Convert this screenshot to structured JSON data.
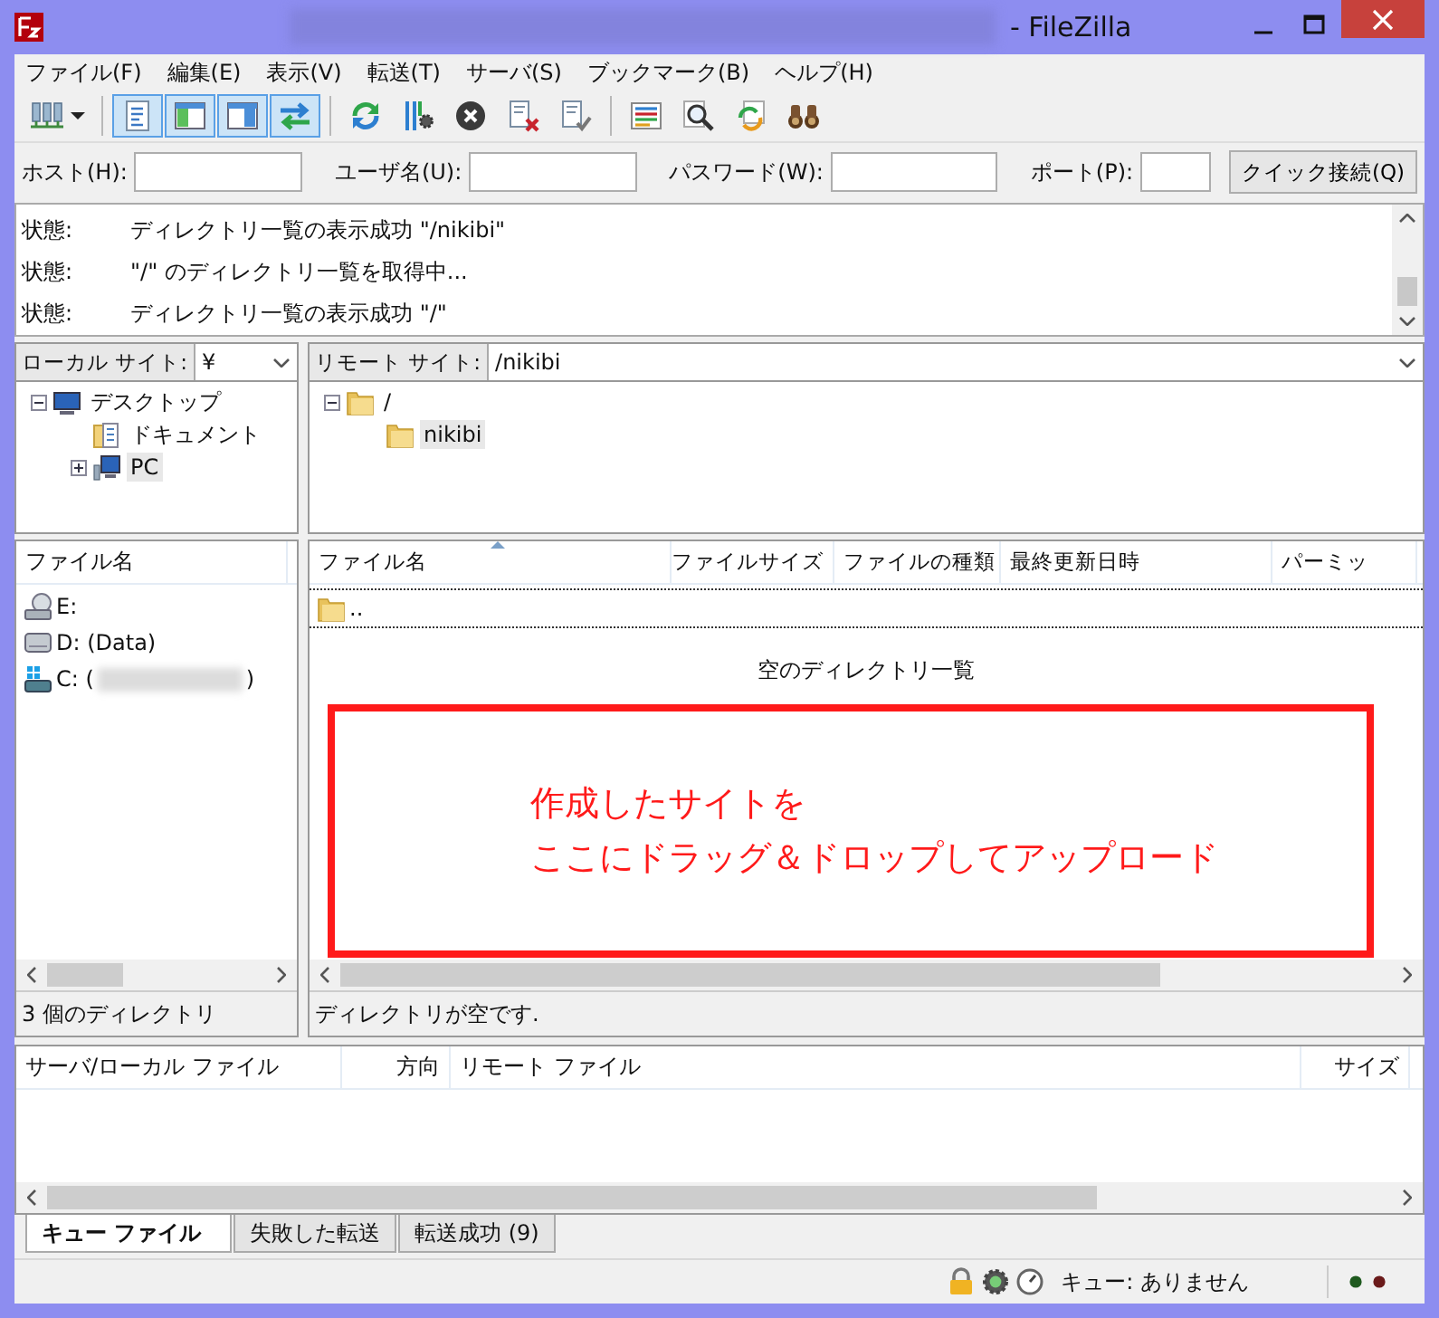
{
  "window": {
    "title": "- FileZilla"
  },
  "menu": [
    "ファイル(F)",
    "編集(E)",
    "表示(V)",
    "転送(T)",
    "サーバ(S)",
    "ブックマーク(B)",
    "ヘルプ(H)"
  ],
  "toolbar": [
    {
      "kind": "site_manager",
      "pressed": false
    },
    {
      "kind": "separator"
    },
    {
      "kind": "message_log",
      "pressed": true
    },
    {
      "kind": "local_tree",
      "pressed": true
    },
    {
      "kind": "remote_tree",
      "pressed": true
    },
    {
      "kind": "transfer_queue",
      "pressed": true
    },
    {
      "kind": "separator"
    },
    {
      "kind": "refresh",
      "pressed": false
    },
    {
      "kind": "filter",
      "pressed": false
    },
    {
      "kind": "cancel",
      "pressed": false
    },
    {
      "kind": "disconnect",
      "pressed": false
    },
    {
      "kind": "reconnect",
      "pressed": false
    },
    {
      "kind": "separator"
    },
    {
      "kind": "list_view",
      "pressed": false
    },
    {
      "kind": "search",
      "pressed": false
    },
    {
      "kind": "sync",
      "pressed": false
    },
    {
      "kind": "compare",
      "pressed": false
    }
  ],
  "quickconnect": {
    "fields": [
      {
        "label": "ホスト(H):"
      },
      {
        "label": "ユーザ名(U):"
      },
      {
        "label": "パスワード(W):"
      },
      {
        "label": "ポート(P):"
      }
    ],
    "button": "クイック接続(Q)"
  },
  "log": [
    {
      "label": "状態:",
      "message": "ディレクトリ一覧の表示成功 \"/nikibi\""
    },
    {
      "label": "状態:",
      "message": "\"/\" のディレクトリ一覧を取得中..."
    },
    {
      "label": "状態:",
      "message": "ディレクトリ一覧の表示成功 \"/\""
    }
  ],
  "local": {
    "site_label": "ローカル サイト:",
    "path": "¥",
    "tree": [
      {
        "label": "デスクトップ",
        "kind": "desktop",
        "expanded": true,
        "selected": false,
        "children": [
          {
            "label": "ドキュメント",
            "kind": "documents",
            "selected": false
          },
          {
            "label": "PC",
            "kind": "computer",
            "expanded": false,
            "selected": true
          }
        ]
      }
    ],
    "columns": [
      "ファイル名"
    ],
    "files": [
      {
        "name": "E:",
        "kind": "optical_drive"
      },
      {
        "name": "D: (Data)",
        "kind": "drive"
      },
      {
        "name": "C: (",
        "kind": "system_drive",
        "after_redaction": ")"
      }
    ],
    "status": "3 個のディレクトリ"
  },
  "remote": {
    "site_label": "リモート サイト:",
    "path": "/nikibi",
    "tree": [
      {
        "label": "/",
        "kind": "folder",
        "expanded": true,
        "selected": false,
        "children": [
          {
            "label": "nikibi",
            "kind": "folder",
            "selected": true
          }
        ]
      }
    ],
    "columns": [
      {
        "label": "ファイル名",
        "sorted": true
      },
      {
        "label": "ファイルサイズ",
        "sorted": false
      },
      {
        "label": "ファイルの種類",
        "sorted": false
      },
      {
        "label": "最終更新日時",
        "sorted": false
      },
      {
        "label": "パーミッ",
        "sorted": false
      }
    ],
    "files": [
      {
        "name": ".."
      }
    ],
    "empty_message": "空のディレクトリ一覧",
    "status": "ディレクトリが空です."
  },
  "annotation": {
    "lines": [
      "作成したサイトを",
      "ここにドラッグ＆ドロップしてアップロード"
    ]
  },
  "queue": {
    "columns": [
      "サーバ/ローカル ファイル",
      "方向",
      "リモート ファイル",
      "サイズ"
    ]
  },
  "tabs": [
    {
      "label": "キュー ファイル",
      "selected": true
    },
    {
      "label": "失敗した転送",
      "selected": false
    },
    {
      "label": "転送成功 (9)",
      "selected": false
    }
  ],
  "status_bar": {
    "queue": "キュー: ありません"
  }
}
